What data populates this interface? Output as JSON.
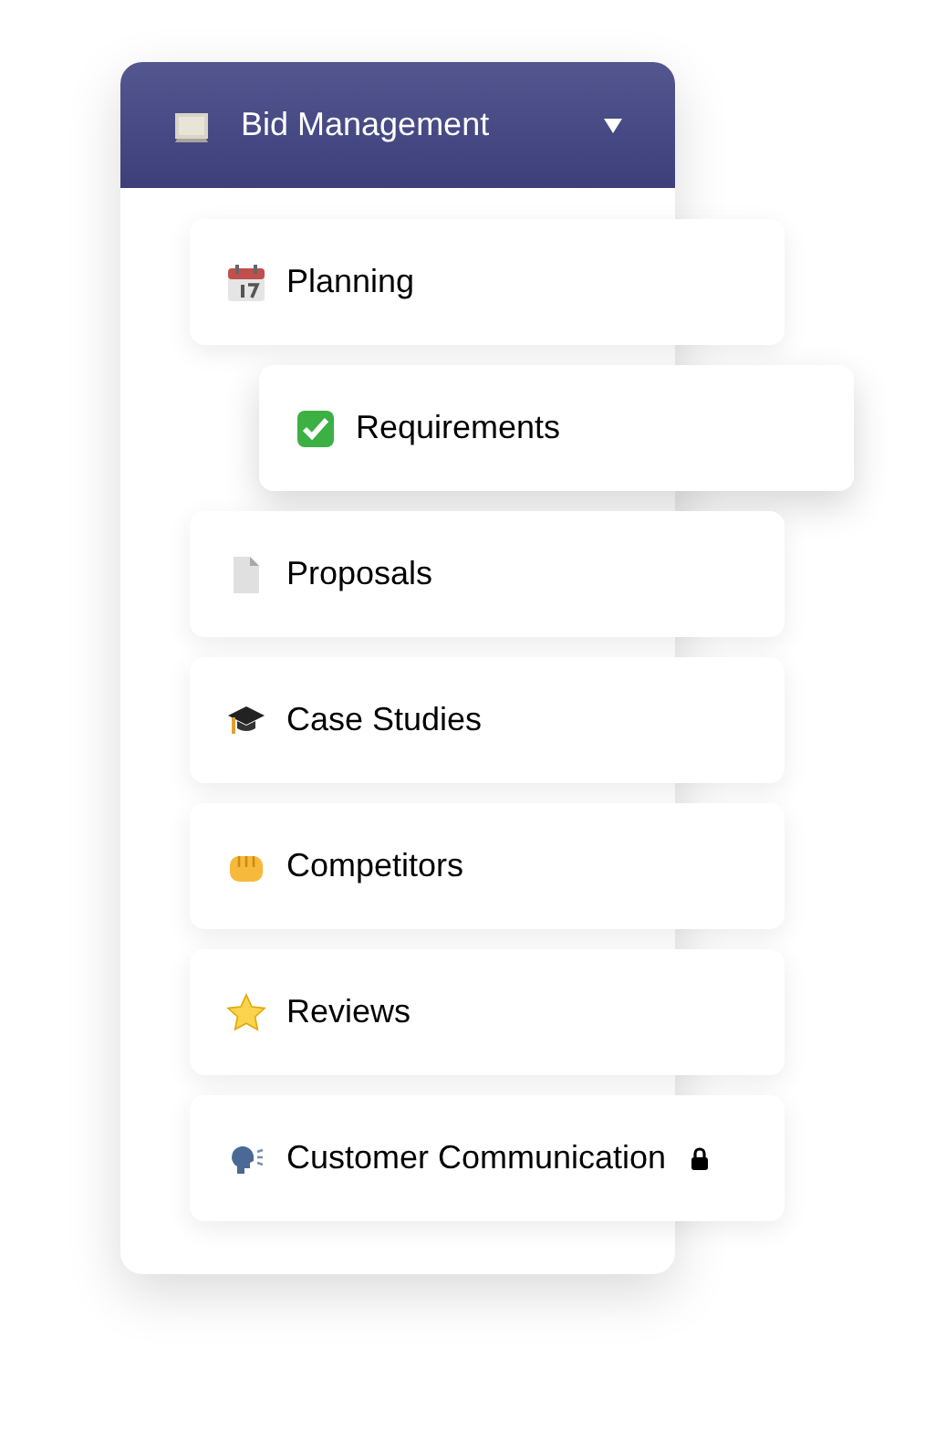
{
  "header": {
    "title": "Bid Management",
    "expanded": true
  },
  "items": [
    {
      "label": "Planning",
      "raised": false,
      "locked": false
    },
    {
      "label": "Requirements",
      "raised": true,
      "locked": false
    },
    {
      "label": "Proposals",
      "raised": false,
      "locked": false
    },
    {
      "label": "Case Studies",
      "raised": false,
      "locked": false
    },
    {
      "label": "Competitors",
      "raised": false,
      "locked": false
    },
    {
      "label": "Reviews",
      "raised": false,
      "locked": false
    },
    {
      "label": "Customer Communication",
      "raised": false,
      "locked": true
    }
  ]
}
